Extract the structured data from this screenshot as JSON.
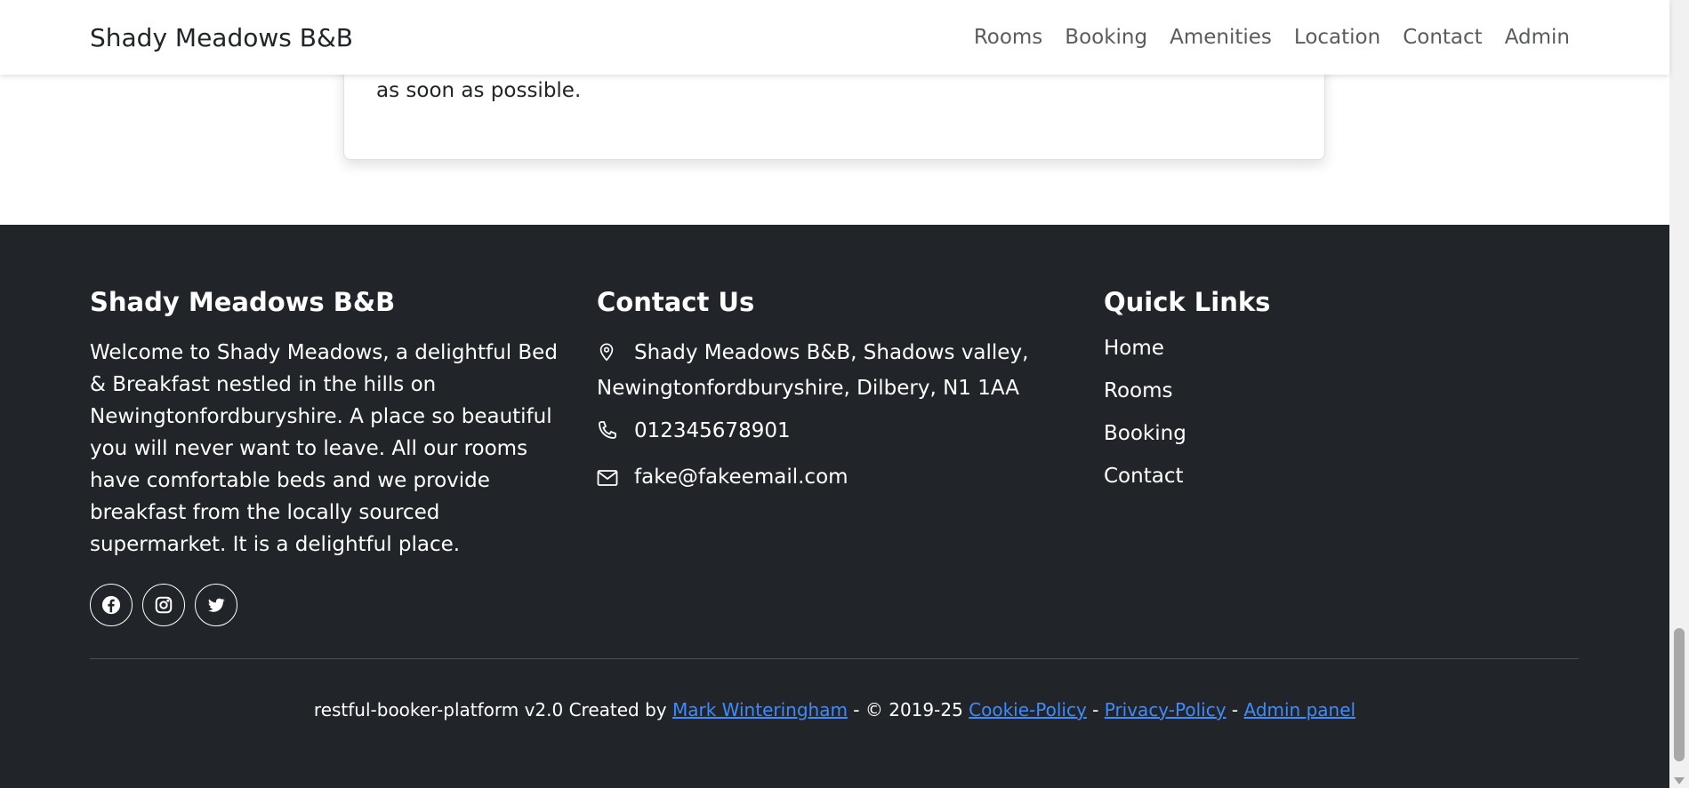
{
  "navbar": {
    "brand": "Shady Meadows B&B",
    "links": [
      "Rooms",
      "Booking",
      "Amenities",
      "Location",
      "Contact",
      "Admin"
    ]
  },
  "card": {
    "text": "as soon as possible."
  },
  "footer": {
    "about": {
      "title": "Shady Meadows B&B",
      "text": "Welcome to Shady Meadows, a delightful Bed & Breakfast nestled in the hills on Newingtonfordburyshire. A place so beautiful you will never want to leave. All our rooms have comfortable beds and we provide breakfast from the locally sourced supermarket. It is a delightful place.",
      "social_icons": [
        "facebook-icon",
        "instagram-icon",
        "twitter-icon"
      ]
    },
    "contact": {
      "title": "Contact Us",
      "address": "Shady Meadows B&B, Shadows valley, Newingtonfordburyshire, Dilbery, N1 1AA",
      "phone": "012345678901",
      "email": "fake@fakeemail.com"
    },
    "quick_links": {
      "title": "Quick Links",
      "links": [
        "Home",
        "Rooms",
        "Booking",
        "Contact"
      ]
    },
    "copyright": {
      "prefix": "restful-booker-platform v2.0 Created by ",
      "author": "Mark Winteringham",
      "middle": " - © 2019-25 ",
      "cookie": "Cookie-Policy",
      "sep1": " - ",
      "privacy": "Privacy-Policy",
      "sep2": " - ",
      "admin": "Admin panel"
    }
  },
  "colors": {
    "footer_bg": "#212529",
    "link": "#3d8bfd"
  }
}
